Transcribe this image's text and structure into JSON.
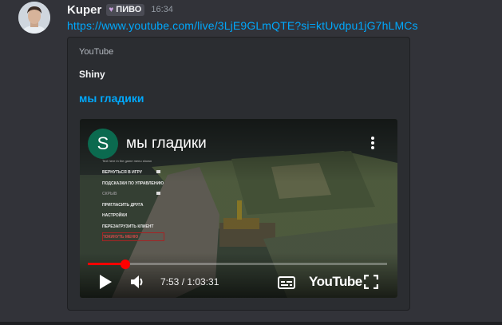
{
  "message": {
    "username": "Kuper",
    "tag": {
      "label": "ПИВО",
      "icon": "heart-icon",
      "color": "#c9a0dc"
    },
    "timestamp": "16:34",
    "link": "https://www.youtube.com/live/3LjE9GLmQTE?si=ktUvdpu1jG7hLMCs"
  },
  "embed": {
    "provider": "YouTube",
    "author": "Shiny",
    "title": "мы гладики",
    "player": {
      "channel_initial": "S",
      "video_title": "мы гладики",
      "game_menu": {
        "hint": "Text here in the game menu shown",
        "items": [
          "ВЕРНУТЬСЯ В ИГРУ",
          "ПОДСКАЗКИ ПО УПРАВЛЕНИЮ",
          "СКРЫВ",
          "ПРИГЛАСИТЬ ДРУГА",
          "НАСТРОЙКИ",
          "ПЕРЕЗАГРУЗИТЬ КЛИЕНТ",
          "ПОКИНУТЬ МЕНЮ"
        ]
      },
      "time": "7:53 / 1:03:31",
      "progress": 0.125,
      "logo_text": "YouTube"
    }
  },
  "colors": {
    "background": "#323339",
    "embed_bg": "#2b2d31",
    "link": "#00a8fc",
    "progress": "#ff0000"
  }
}
